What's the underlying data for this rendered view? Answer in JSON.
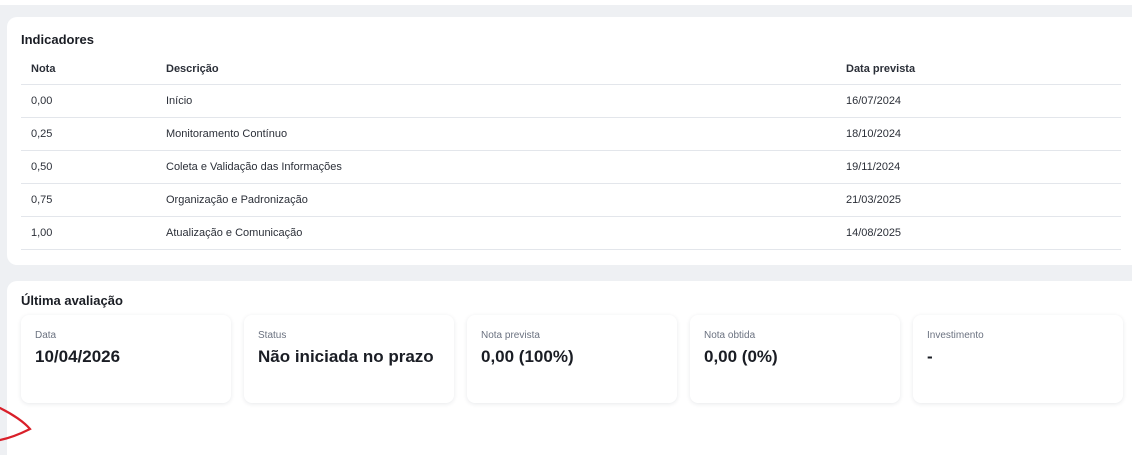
{
  "indicators": {
    "title": "Indicadores",
    "columns": {
      "nota": "Nota",
      "descricao": "Descrição",
      "data_prevista": "Data prevista"
    },
    "rows": [
      {
        "nota": "0,00",
        "descricao": "Início",
        "data_prevista": "16/07/2024"
      },
      {
        "nota": "0,25",
        "descricao": "Monitoramento Contínuo",
        "data_prevista": "18/10/2024"
      },
      {
        "nota": "0,50",
        "descricao": "Coleta e Validação das Informações",
        "data_prevista": "19/11/2024"
      },
      {
        "nota": "0,75",
        "descricao": "Organização e Padronização",
        "data_prevista": "21/03/2025"
      },
      {
        "nota": "1,00",
        "descricao": "Atualização e Comunicação",
        "data_prevista": "14/08/2025"
      }
    ]
  },
  "last_evaluation": {
    "title": "Última avaliação",
    "metrics": {
      "data": {
        "label": "Data",
        "value": "10/04/2026"
      },
      "status": {
        "label": "Status",
        "value": "Não iniciada no prazo"
      },
      "nota_prevista": {
        "label": "Nota prevista",
        "value": "0,00 (100%)"
      },
      "nota_obtida": {
        "label": "Nota obtida",
        "value": "0,00 (0%)"
      },
      "investimento": {
        "label": "Investimento",
        "value": "-"
      }
    }
  },
  "colors": {
    "background": "#eef0f3",
    "card": "#ffffff",
    "divider": "#e3e6eb",
    "annotation_mark": "#d9202a"
  }
}
